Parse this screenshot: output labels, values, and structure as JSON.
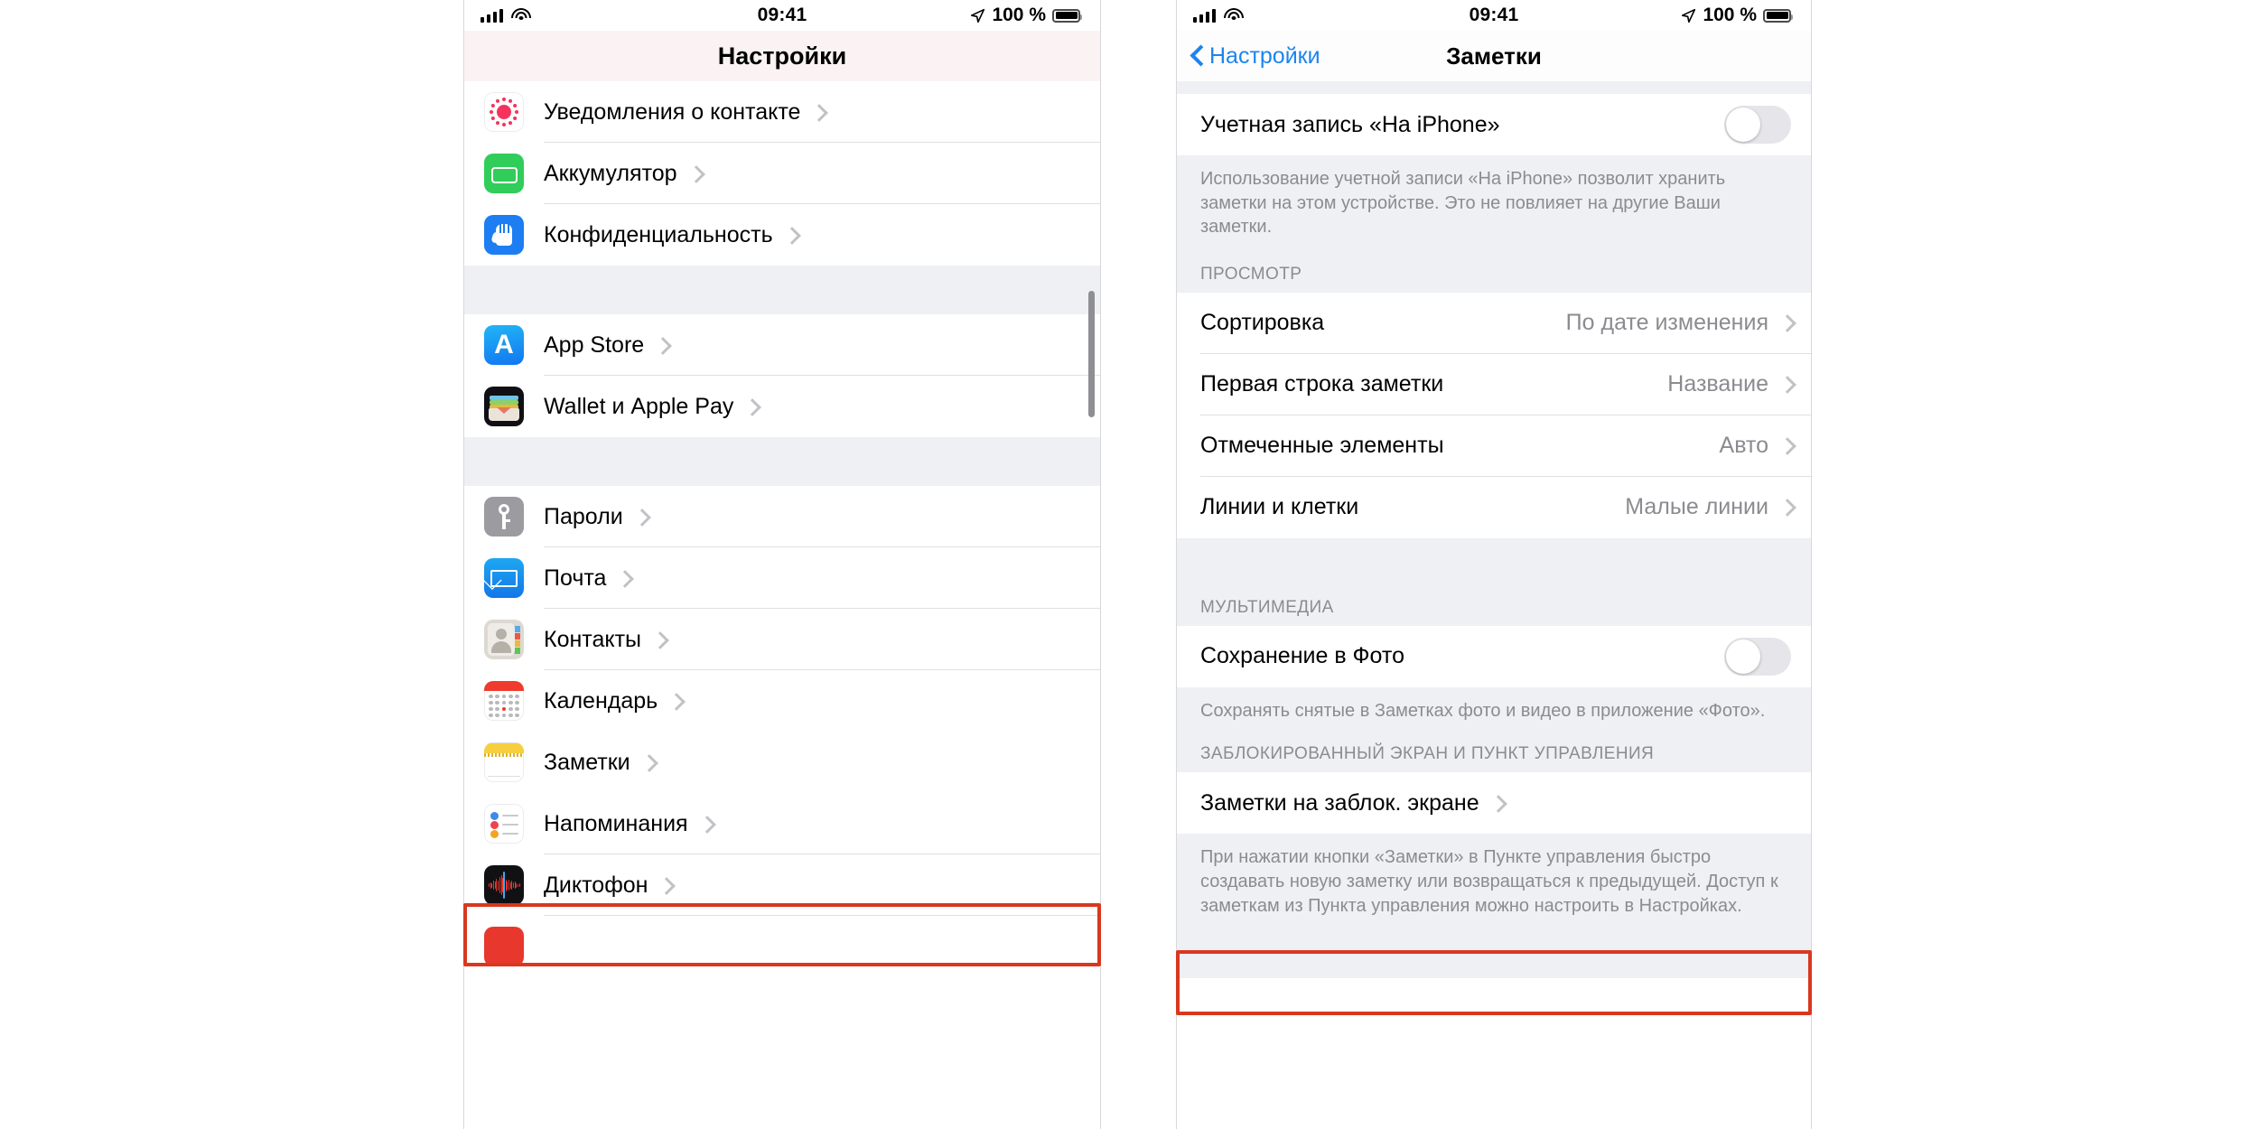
{
  "status_bar": {
    "time": "09:41",
    "battery_percent": "100 %",
    "icons": [
      "cellular-signal-icon",
      "wifi-icon",
      "location-arrow-icon",
      "battery-icon"
    ]
  },
  "left_panel": {
    "nav_title": "Настройки",
    "groups": [
      {
        "items": [
          {
            "label": "Уведомления о контакте",
            "icon": "contact-notifications-icon"
          },
          {
            "label": "Аккумулятор",
            "icon": "battery-app-icon"
          },
          {
            "label": "Конфиденциальность",
            "icon": "privacy-hand-icon"
          }
        ]
      },
      {
        "items": [
          {
            "label": "App Store",
            "icon": "app-store-icon"
          },
          {
            "label": "Wallet и Apple Pay",
            "icon": "wallet-icon"
          }
        ]
      },
      {
        "items": [
          {
            "label": "Пароли",
            "icon": "passwords-key-icon"
          },
          {
            "label": "Почта",
            "icon": "mail-icon"
          },
          {
            "label": "Контакты",
            "icon": "contacts-icon"
          },
          {
            "label": "Календарь",
            "icon": "calendar-icon"
          },
          {
            "label": "Заметки",
            "icon": "notes-icon",
            "highlighted": true
          },
          {
            "label": "Напоминания",
            "icon": "reminders-icon"
          },
          {
            "label": "Диктофон",
            "icon": "voice-memos-icon"
          }
        ]
      }
    ]
  },
  "right_panel": {
    "back_label": "Настройки",
    "nav_title": "Заметки",
    "account_row": {
      "label": "Учетная запись «На iPhone»",
      "toggle_on": false
    },
    "account_note": "Использование учетной записи «На iPhone» позволит хранить заметки на этом устройстве. Это не повлияет на другие Ваши заметки.",
    "view_section_header": "ПРОСМОТР",
    "view_rows": [
      {
        "label": "Сортировка",
        "value": "По дате изменения"
      },
      {
        "label": "Первая строка заметки",
        "value": "Название"
      },
      {
        "label": "Отмеченные элементы",
        "value": "Авто"
      },
      {
        "label": "Линии и клетки",
        "value": "Малые линии"
      }
    ],
    "media_section_header": "МУЛЬТИМЕДИА",
    "media_row": {
      "label": "Сохранение в Фото",
      "toggle_on": false
    },
    "media_note": "Сохранять снятые в Заметках фото и видео в приложение «Фото».",
    "lock_section_header": "ЗАБЛОКИРОВАННЫЙ ЭКРАН И ПУНКТ УПРАВЛЕНИЯ",
    "lock_row": {
      "label": "Заметки на заблок. экране",
      "highlighted": true
    },
    "lock_note": "При нажатии кнопки «Заметки» в Пункте управления быстро создавать новую заметку или возвращаться к предыдущей. Доступ к заметкам из Пункта управления можно настроить в Настройках."
  },
  "colors": {
    "accent_blue": "#1c84f0",
    "highlight_red": "#d9381e",
    "group_bg": "#eff0f4",
    "secondary_text": "#8b8b90"
  }
}
